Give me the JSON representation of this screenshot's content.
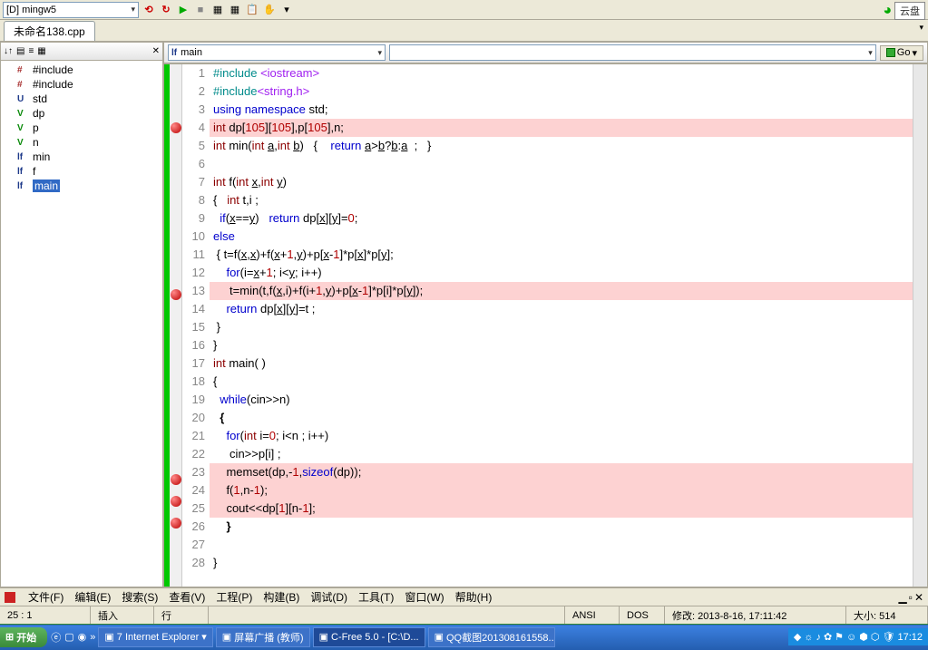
{
  "toolbar": {
    "compiler": "[D] mingw5"
  },
  "top_right": {
    "yunpan": "云盘"
  },
  "tab": "未命名138.cpp",
  "sidebar": [
    {
      "ico": "#",
      "cls": "t-hash",
      "label": "#include <iostream>"
    },
    {
      "ico": "#",
      "cls": "t-hash",
      "label": "#include <string.h>"
    },
    {
      "ico": "U",
      "cls": "t-u",
      "label": "std"
    },
    {
      "ico": "V",
      "cls": "t-v",
      "label": "dp"
    },
    {
      "ico": "V",
      "cls": "t-v",
      "label": "p"
    },
    {
      "ico": "V",
      "cls": "t-v",
      "label": "n"
    },
    {
      "ico": "lf",
      "cls": "t-lf",
      "label": "min"
    },
    {
      "ico": "lf",
      "cls": "t-lf",
      "label": "f"
    },
    {
      "ico": "lf",
      "cls": "t-lf",
      "label": "main",
      "sel": true
    }
  ],
  "editor_bar": {
    "scope_icon": "lf",
    "scope": "main",
    "go": "Go"
  },
  "code": [
    {
      "n": 1,
      "hl": false,
      "bp": false,
      "html": "<span class='pp'>#include</span> <span class='str'>&lt;iostream&gt;</span>"
    },
    {
      "n": 2,
      "hl": false,
      "bp": false,
      "html": "<span class='pp'>#include</span><span class='str'>&lt;string.h&gt;</span>"
    },
    {
      "n": 3,
      "hl": false,
      "bp": false,
      "html": "<span class='kw'>using</span> <span class='kw'>namespace</span> std;"
    },
    {
      "n": 4,
      "hl": true,
      "bp": true,
      "html": "<span class='type'>int</span> dp[<span class='num'>105</span>][<span class='num'>105</span>],p[<span class='num'>105</span>],n;"
    },
    {
      "n": 5,
      "hl": false,
      "bp": false,
      "html": "<span class='type'>int</span> min(<span class='type'>int</span> <span class='und'>a</span>,<span class='type'>int</span> <span class='und'>b</span>)   {    <span class='kw'>return</span> <span class='und'>a</span>&gt;<span class='und'>b</span>?<span class='und'>b</span>:<span class='und'>a</span>  ;   }"
    },
    {
      "n": 6,
      "hl": false,
      "bp": false,
      "html": ""
    },
    {
      "n": 7,
      "hl": false,
      "bp": false,
      "html": "<span class='type'>int</span> f(<span class='type'>int</span> <span class='und'>x</span>,<span class='type'>int</span> <span class='und'>y</span>)"
    },
    {
      "n": 8,
      "hl": false,
      "bp": false,
      "html": "{   <span class='type'>int</span> t,i ;"
    },
    {
      "n": 9,
      "hl": false,
      "bp": false,
      "html": "  <span class='kw'>if</span>(<span class='und'>x</span>==<span class='und'>y</span>)   <span class='kw'>return</span> dp[<span class='und'>x</span>][<span class='und'>y</span>]=<span class='num'>0</span>;"
    },
    {
      "n": 10,
      "hl": false,
      "bp": false,
      "html": "<span class='kw'>else</span>"
    },
    {
      "n": 11,
      "hl": false,
      "bp": false,
      "html": " { t=f(<span class='und'>x</span>,<span class='und'>x</span>)+f(<span class='und'>x</span>+<span class='num'>1</span>,<span class='und'>y</span>)+p[<span class='und'>x</span>-<span class='num'>1</span>]*p[<span class='und'>x</span>]*p[<span class='und'>y</span>];"
    },
    {
      "n": 12,
      "hl": false,
      "bp": false,
      "html": "    <span class='kw'>for</span>(i=<span class='und'>x</span>+<span class='num'>1</span>; i&lt;<span class='und'>y</span>; i++)"
    },
    {
      "n": 13,
      "hl": true,
      "bp": true,
      "html": "     t=min(t,f(<span class='und'>x</span>,i)+f(i+<span class='num'>1</span>,<span class='und'>y</span>)+p[<span class='und'>x</span>-<span class='num'>1</span>]*p[i]*p[<span class='und'>y</span>]);"
    },
    {
      "n": 14,
      "hl": false,
      "bp": false,
      "html": "    <span class='kw'>return</span> dp[<span class='und'>x</span>][<span class='und'>y</span>]=t ;"
    },
    {
      "n": 15,
      "hl": false,
      "bp": false,
      "html": " }"
    },
    {
      "n": 16,
      "hl": false,
      "bp": false,
      "html": "}"
    },
    {
      "n": 17,
      "hl": false,
      "bp": false,
      "html": "<span class='type'>int</span> main( )"
    },
    {
      "n": 18,
      "hl": false,
      "bp": false,
      "html": "{"
    },
    {
      "n": 19,
      "hl": false,
      "bp": false,
      "html": "  <span class='kw'>while</span>(cin&gt;&gt;n)"
    },
    {
      "n": 20,
      "hl": false,
      "bp": false,
      "html": "  <b>{</b>"
    },
    {
      "n": 21,
      "hl": false,
      "bp": false,
      "html": "    <span class='kw'>for</span>(<span class='type'>int</span> i=<span class='num'>0</span>; i&lt;n ; i++)"
    },
    {
      "n": 22,
      "hl": false,
      "bp": false,
      "html": "     cin&gt;&gt;p[i] ;"
    },
    {
      "n": 23,
      "hl": true,
      "bp": true,
      "html": "    memset(dp,-<span class='num'>1</span>,<span class='kw'>sizeof</span>(dp));"
    },
    {
      "n": 24,
      "hl": true,
      "bp": true,
      "html": "    f(<span class='num'>1</span>,n-<span class='num'>1</span>);"
    },
    {
      "n": 25,
      "hl": true,
      "bp": true,
      "html": "    cout&lt;&lt;dp[<span class='num'>1</span>][n-<span class='num'>1</span>];"
    },
    {
      "n": 26,
      "hl": false,
      "bp": false,
      "html": "    <b>}</b>"
    },
    {
      "n": 27,
      "hl": false,
      "bp": false,
      "html": ""
    },
    {
      "n": 28,
      "hl": false,
      "bp": false,
      "html": "}"
    }
  ],
  "menus": [
    "文件(F)",
    "编辑(E)",
    "搜索(S)",
    "查看(V)",
    "工程(P)",
    "构建(B)",
    "调试(D)",
    "工具(T)",
    "窗口(W)",
    "帮助(H)"
  ],
  "status": {
    "pos": "25 :  1",
    "mode": "插入",
    "line": "行",
    "enc": "ANSI",
    "eol": "DOS",
    "mod": "修改: 2013-8-16, 17:11:42",
    "size": "大小:  514"
  },
  "taskbar": {
    "start": "开始",
    "items": [
      {
        "label": "7 Internet Explorer",
        "dd": true
      },
      {
        "label": "屏幕广播 (教师)"
      },
      {
        "label": "C-Free 5.0 - [C:\\D...",
        "active": true
      },
      {
        "label": "QQ截图201308161558..."
      }
    ],
    "time": "17:12"
  }
}
